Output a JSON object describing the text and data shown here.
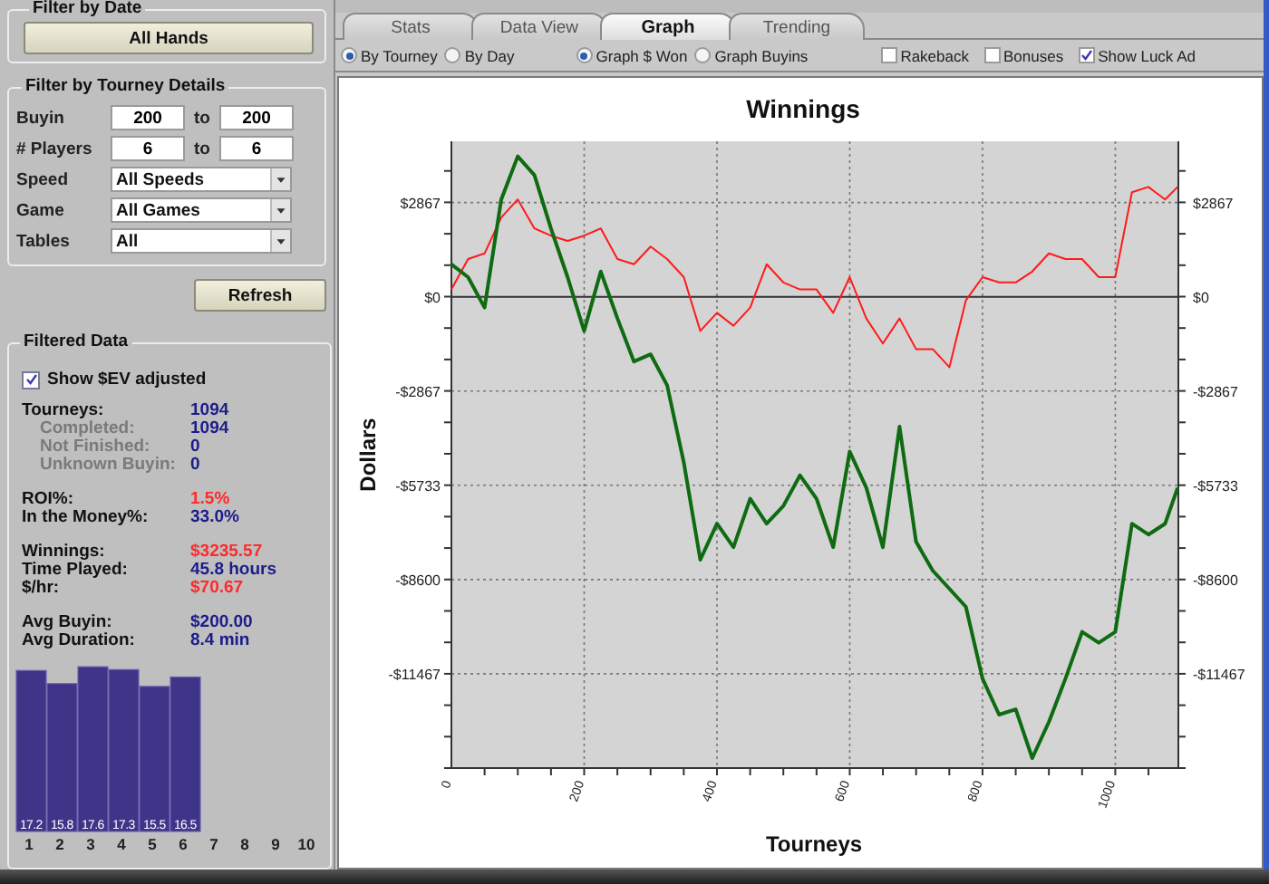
{
  "filter_by_date": {
    "title": "Filter by Date",
    "button": "All Hands"
  },
  "filter_by_tourney_details": {
    "title": "Filter by Tourney Details",
    "ranges": [
      {
        "label": "Buyin",
        "from": "200",
        "to_label": "to",
        "to": "200"
      },
      {
        "label": "# Players",
        "from": "6",
        "to_label": "to",
        "to": "6"
      }
    ],
    "selects": [
      {
        "label": "Speed",
        "value": "All Speeds"
      },
      {
        "label": "Game",
        "value": "All Games"
      },
      {
        "label": "Tables",
        "value": "All"
      }
    ]
  },
  "refresh_button": "Refresh",
  "filtered_data": {
    "title": "Filtered Data",
    "show_ev": {
      "label": "Show $EV adjusted",
      "checked": true
    },
    "stat_groups": [
      [
        {
          "kind": "main",
          "label": "Tourneys:",
          "value": "1094",
          "color": "#1c1c8a"
        },
        {
          "kind": "sub",
          "label": "Completed:",
          "value": "1094",
          "color": "#1c1c8a"
        },
        {
          "kind": "sub",
          "label": "Not Finished:",
          "value": "0",
          "color": "#1c1c8a"
        },
        {
          "kind": "sub",
          "label": "Unknown Buyin:",
          "value": "0",
          "color": "#1c1c8a"
        }
      ],
      [
        {
          "kind": "main",
          "label": "ROI%:",
          "value": "1.5%",
          "color": "#ff2a2a"
        },
        {
          "kind": "main",
          "label": "In the Money%:",
          "value": "33.0%",
          "color": "#1c1c8a"
        }
      ],
      [
        {
          "kind": "main",
          "label": "Winnings:",
          "value": "$3235.57",
          "color": "#ff2a2a"
        },
        {
          "kind": "main",
          "label": "Time Played:",
          "value": "45.8 hours",
          "color": "#1c1c8a"
        },
        {
          "kind": "main",
          "label": "$/hr:",
          "value": "$70.67",
          "color": "#ff2a2a"
        }
      ],
      [
        {
          "kind": "main",
          "label": "Avg Buyin:",
          "value": "$200.00",
          "color": "#1c1c8a"
        },
        {
          "kind": "main",
          "label": "Avg Duration:",
          "value": "8.4 min",
          "color": "#1c1c8a"
        }
      ]
    ],
    "chart_data": {
      "type": "bar",
      "categories": [
        "1",
        "2",
        "3",
        "4",
        "5",
        "6",
        "7",
        "8",
        "9",
        "10"
      ],
      "ylim": [
        0,
        18
      ],
      "data_labels": true,
      "series": [
        {
          "color": "#3e3488",
          "values": [
            17.2,
            15.8,
            17.6,
            17.3,
            15.5,
            16.5,
            null,
            null,
            null,
            null
          ]
        }
      ]
    }
  },
  "tabs": [
    {
      "label": "Stats",
      "selected": false
    },
    {
      "label": "Data View",
      "selected": false
    },
    {
      "label": "Graph",
      "selected": true
    },
    {
      "label": "Trending",
      "selected": false
    }
  ],
  "radio_groups": [
    [
      {
        "label": "By Tourney",
        "selected": true
      },
      {
        "label": "By Day",
        "selected": false
      }
    ],
    [
      {
        "label": "Graph $ Won",
        "selected": true
      },
      {
        "label": "Graph Buyins",
        "selected": false
      }
    ]
  ],
  "checkboxes": [
    {
      "label": "Rakeback",
      "checked": false
    },
    {
      "label": "Bonuses",
      "checked": false
    },
    {
      "label": "Show Luck Ad",
      "checked": true
    }
  ],
  "graph": {
    "chart_data": {
      "type": "line",
      "title": "Winnings",
      "xlabel": "Tourneys",
      "ylabel": "Dollars",
      "x": [
        0,
        25,
        50,
        75,
        100,
        125,
        150,
        175,
        200,
        225,
        250,
        275,
        300,
        325,
        350,
        375,
        400,
        425,
        450,
        475,
        500,
        525,
        550,
        575,
        600,
        625,
        650,
        675,
        700,
        725,
        750,
        775,
        800,
        825,
        850,
        875,
        900,
        925,
        950,
        975,
        1000,
        1025,
        1050,
        1075,
        1094
      ],
      "xlim": [
        0,
        1095
      ],
      "ylim": [
        -14335,
        4730
      ],
      "grid": true,
      "xticks": [
        0,
        200,
        400,
        600,
        800,
        1000
      ],
      "yticks": [
        {
          "value": 2867,
          "label": "$2867"
        },
        {
          "value": 0,
          "label": "$0"
        },
        {
          "value": -2867,
          "label": "-$2867"
        },
        {
          "value": -5733,
          "label": "-$5733"
        },
        {
          "value": -8600,
          "label": "-$8600"
        },
        {
          "value": -11467,
          "label": "-$11467"
        }
      ],
      "series": [
        {
          "color": "#ff1a1a",
          "values": [
            220,
            1150,
            1320,
            2410,
            2960,
            2080,
            1860,
            1700,
            1860,
            2080,
            1150,
            990,
            1530,
            1150,
            600,
            -1040,
            -490,
            -880,
            -330,
            990,
            440,
            220,
            220,
            -490,
            600,
            -660,
            -1420,
            -660,
            -1590,
            -1590,
            -2140,
            -110,
            600,
            440,
            440,
            770,
            1320,
            1150,
            1150,
            600,
            600,
            3180,
            3340,
            2960,
            3340
          ]
        },
        {
          "color": "#0f6b12",
          "values": [
            990,
            600,
            -330,
            2960,
            4270,
            3700,
            2080,
            600,
            -1040,
            770,
            -660,
            -1970,
            -1750,
            -2690,
            -5040,
            -8000,
            -6900,
            -7620,
            -6140,
            -6900,
            -6360,
            -5430,
            -6140,
            -7620,
            -4710,
            -5810,
            -7620,
            -3950,
            -7450,
            -8330,
            -8880,
            -9430,
            -11620,
            -12710,
            -12550,
            -14030,
            -12930,
            -11620,
            -10190,
            -10520,
            -10190,
            -6900,
            -7230,
            -6900,
            -5810
          ]
        }
      ]
    }
  }
}
